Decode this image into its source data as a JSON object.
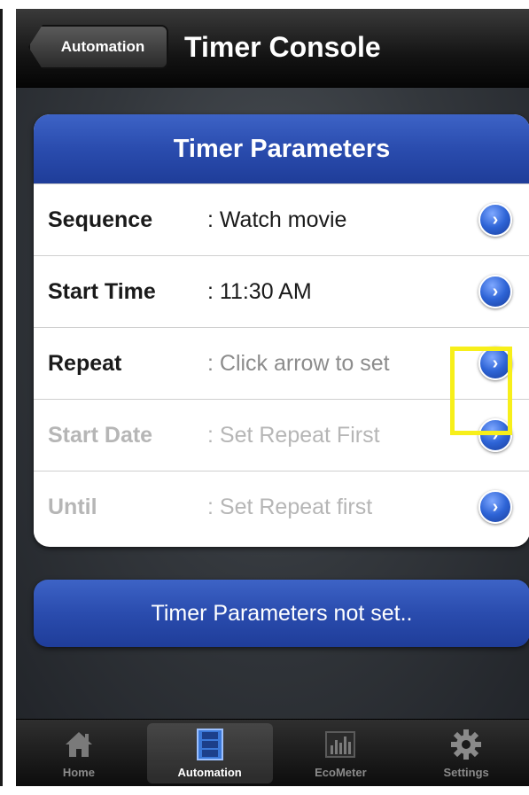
{
  "navbar": {
    "back_label": "Automation",
    "title": "Timer Console"
  },
  "card": {
    "header": "Timer Parameters",
    "rows": [
      {
        "label": "Sequence",
        "value": ": Watch movie"
      },
      {
        "label": "Start Time",
        "value": ": 11:30 AM"
      },
      {
        "label": "Repeat",
        "value": ": Click arrow to set"
      },
      {
        "label": "Start Date",
        "value": ": Set Repeat First"
      },
      {
        "label": "Until",
        "value": ": Set Repeat first"
      }
    ]
  },
  "status_button": "Timer Parameters not set..",
  "tabbar": {
    "tabs": [
      {
        "label": "Home",
        "icon": "house-icon"
      },
      {
        "label": "Automation",
        "icon": "film-icon"
      },
      {
        "label": "EcoMeter",
        "icon": "bar-chart-icon"
      },
      {
        "label": "Settings",
        "icon": "gear-icon"
      }
    ],
    "active": "Automation"
  },
  "colors": {
    "header_blue": "#2a4cae",
    "highlight": "#f7ef1a",
    "navbar": "#141414"
  }
}
